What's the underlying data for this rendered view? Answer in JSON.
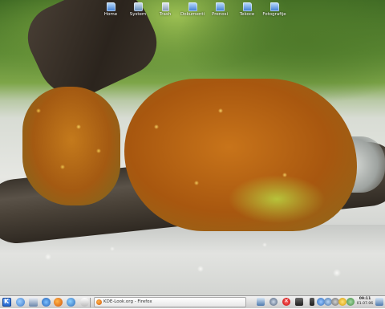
{
  "desktop": {
    "icons": [
      {
        "label": "Home",
        "icon": "home-folder-icon"
      },
      {
        "label": "System",
        "icon": "computer-icon"
      },
      {
        "label": "Trash",
        "icon": "trash-icon"
      },
      {
        "label": "Dokumenti",
        "icon": "folder-icon"
      },
      {
        "label": "Prenosi",
        "icon": "folder-icon"
      },
      {
        "label": "Tekoce",
        "icon": "folder-icon"
      },
      {
        "label": "Fotografije",
        "icon": "folder-icon"
      }
    ]
  },
  "taskbar": {
    "launchers": [
      "kde-menu-icon",
      "konqueror-icon",
      "system-icon",
      "kmail-icon",
      "firefox-icon",
      "network-icon",
      "clock-app-icon"
    ],
    "task": {
      "label": "KDE-Look.org - Firefox",
      "icon": "firefox-icon"
    },
    "tray": [
      "network-icon",
      "update-icon",
      "close-icon",
      "terminal-icon",
      "battery-icon",
      "bluetooth-icon",
      "volume-icon",
      "printer-icon",
      "notes-icon",
      "klipper-icon"
    ],
    "clock": {
      "time": "09:11",
      "date": "01.07.06"
    }
  }
}
